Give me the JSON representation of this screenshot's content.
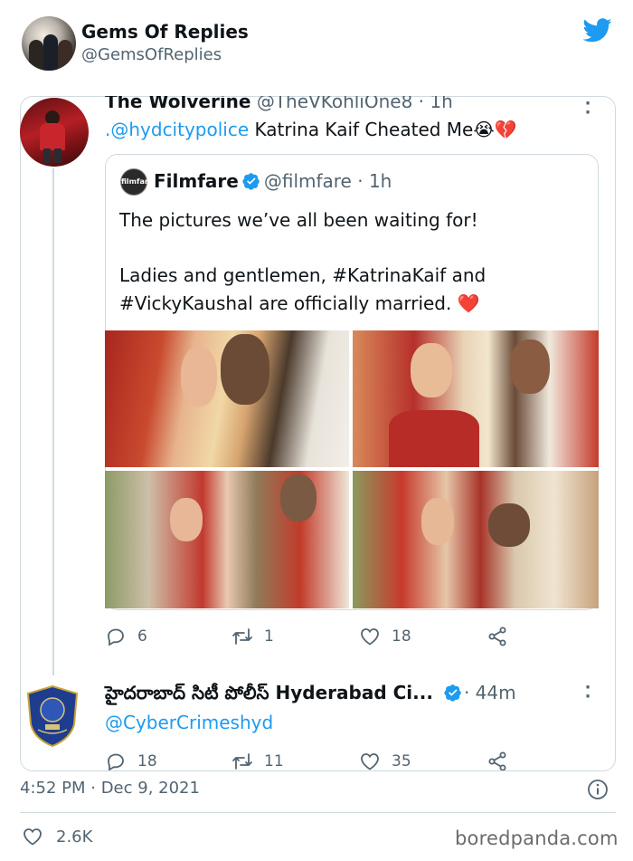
{
  "outer_tweet": {
    "display_name": "Gems Of Replies",
    "handle": "@GemsOfReplies",
    "timestamp": "4:52 PM · Dec 9, 2021",
    "likes": "2.6K"
  },
  "thread": {
    "reply": {
      "display_name": "The Wolverine",
      "handle_time": "@TheVKohliOne8 · 1h",
      "mention": ".@hydcitypolice",
      "text": " Katrina Kaif Cheated Me😭💔",
      "counts": {
        "replies": "6",
        "retweets": "1",
        "likes": "18"
      }
    },
    "quoted": {
      "avatar_text": "filmfare",
      "display_name": "Filmfare",
      "handle_time": "@filmfare · 1h",
      "line1": "The pictures we’ve all been waiting for!",
      "line2": "Ladies and gentlemen, #KatrinaKaif and",
      "line3": "#VickyKaushal are officially married.",
      "emoji": "❤️"
    },
    "police_reply": {
      "display_name": "హైదరాబాద్ సిటీ పోలీస్ Hyderabad Ci...",
      "time": "· 44m",
      "mention": "@CyberCrimeshyd",
      "counts": {
        "replies": "18",
        "retweets": "11",
        "likes": "35"
      }
    }
  },
  "watermark": "boredpanda.com",
  "colors": {
    "link": "#1d9bf0",
    "muted": "#536471",
    "border": "#cfd9de",
    "heart": "#e0245e"
  }
}
